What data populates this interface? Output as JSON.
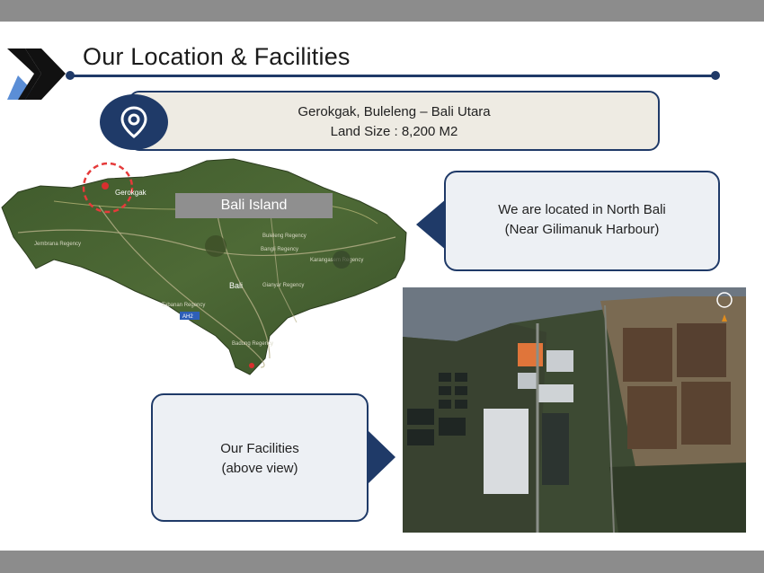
{
  "slide": {
    "title": "Our Location & Facilities",
    "location": {
      "line1": "Gerokgak, Buleleng – Bali Utara",
      "line2": "Land Size : 8,200 M2",
      "icon": "location-pin-icon"
    },
    "map": {
      "island_label": "Bali Island",
      "marker_label": "Gerokgak",
      "region_labels": [
        "Jembrana Regency",
        "Buleleng Regency",
        "Karangasem Regency",
        "Tabanan Regency",
        "Bangli Regency",
        "Gianyar Regency",
        "Badung Regency",
        "Bali"
      ],
      "road_badge": "AH2"
    },
    "callout_location": {
      "line1": "We are located in North Bali",
      "line2": "(Near Gilimanuk Harbour)"
    },
    "callout_facilities": {
      "line1": "Our Facilities",
      "line2": "(above view)"
    },
    "colors": {
      "accent": "#1f3a68",
      "logo_black": "#111111",
      "logo_blue": "#5b8ed6",
      "info_fill": "#eeebe3",
      "callout_fill": "#edf0f4",
      "label_gray": "#8f8f8f"
    }
  }
}
